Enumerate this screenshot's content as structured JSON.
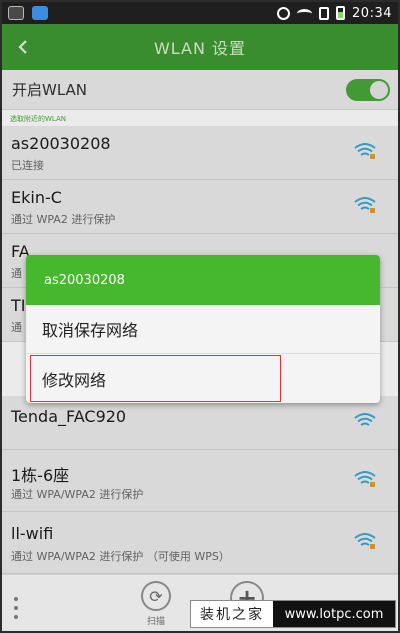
{
  "status_bar": {
    "time": "20:34",
    "left_icons": [
      "camera-app-icon",
      "cloud-app-icon"
    ],
    "right_icons": [
      "alarm-icon",
      "wifi-icon",
      "sim-icon",
      "battery-icon"
    ]
  },
  "app_bar": {
    "title": "WLAN 设置"
  },
  "wlan_toggle": {
    "label": "开启WLAN",
    "enabled": true
  },
  "section_label": "选取附近的WLAN",
  "networks": [
    {
      "ssid": "as20030208",
      "status": "已连接"
    },
    {
      "ssid": "Ekin-C",
      "status": "通过 WPA2 进行保护"
    },
    {
      "ssid": "FA",
      "status": "通"
    },
    {
      "ssid": "TI",
      "status": "通"
    },
    {
      "ssid": "Tenda_FAC920",
      "status": ""
    },
    {
      "ssid": "1栋-6座",
      "status": "通过 WPA/WPA2 进行保护"
    },
    {
      "ssid": "ll-wifi",
      "status": "通过 WPA/WPA2 进行保护 （可使用 WPS）"
    }
  ],
  "dialog": {
    "title": "as20030208",
    "options": [
      "取消保存网络",
      "修改网络"
    ]
  },
  "bottom_bar": {
    "scan_label": "扫描",
    "add_glyph": "+"
  },
  "watermark": {
    "left": "装机之家",
    "right": "www.lotpc.com"
  },
  "colors": {
    "app_bar": "#3f9a32",
    "dialog_header": "#46b82e",
    "highlight": "#d9363e"
  }
}
